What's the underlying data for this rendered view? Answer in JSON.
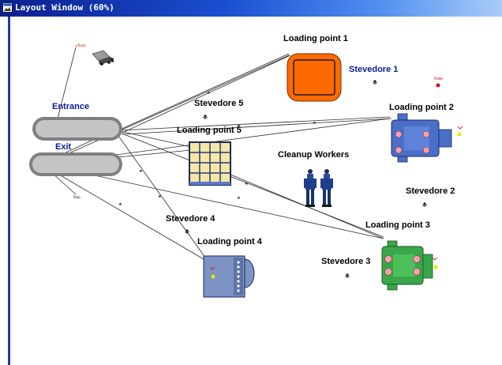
{
  "window": {
    "title": "Layout Window (60%)"
  },
  "colors": {
    "titlebar": "#1a4fd0",
    "loading_point_1": "#ff6a00",
    "loading_point_2": "#4a6fc8",
    "loading_point_3": "#3aa64a",
    "loading_point_4": "#7d93c4",
    "loading_point_5": "#f5e7a6",
    "path": "#808080"
  },
  "labels": {
    "loading_point_1": "Loading point 1",
    "loading_point_2": "Loading point 2",
    "loading_point_3": "Loading point 3",
    "loading_point_4": "Loading point 4",
    "loading_point_5": "Loading point 5",
    "stevedore_1": "Stevedore 1",
    "stevedore_2": "Stevedore 2",
    "stevedore_3": "Stevedore 3",
    "stevedore_4": "Stevedore 4",
    "stevedore_5": "Stevedore 5",
    "entrance": "Entrance",
    "exit": "Exit",
    "cleanup_workers": "Cleanup Workers",
    "truck_tag": "Truck",
    "ship_tag": "Ship",
    "pallet_tag": "Pallet"
  },
  "icons": {
    "title_icon": "window-icon",
    "truck": "truck-icon",
    "worker": "worker-icon",
    "stevedore": "stevedore-icon"
  }
}
